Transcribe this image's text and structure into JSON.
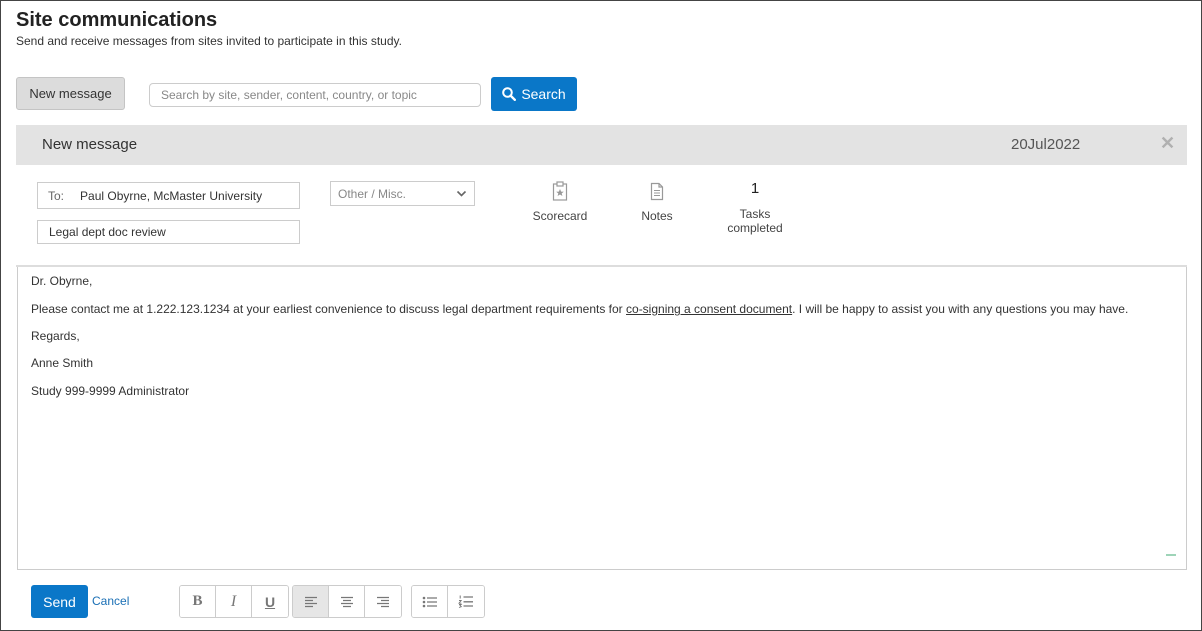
{
  "header": {
    "title": "Site communications",
    "subtitle": "Send and receive messages from sites invited to participate in this study."
  },
  "toolbar": {
    "new_message_label": "New message",
    "search_placeholder": "Search by site, sender, content, country, or topic",
    "search_label": "Search"
  },
  "panel": {
    "title": "New message",
    "date": "20Jul2022",
    "close_icon": "close-icon"
  },
  "compose": {
    "to_label": "To:",
    "to_value": "Paul Obyrne, McMaster University",
    "subject_value": "Legal dept doc review",
    "category_selected": "Other / Misc."
  },
  "tools": {
    "scorecard_label": "Scorecard",
    "notes_label": "Notes",
    "tasks_count": "1",
    "tasks_label": "Tasks completed"
  },
  "body": {
    "greeting": "Dr. Obyrne,",
    "para_before_link": "Please contact me at 1.222.123.1234 at your earliest convenience to discuss legal department requirements for ",
    "link_text": "co-signing a consent document",
    "para_after_link": ". I will be happy to assist you with any questions you may have.",
    "closing": "Regards,",
    "sender_name": "Anne Smith",
    "sender_title": "Study 999-9999 Administrator"
  },
  "footer": {
    "send_label": "Send",
    "cancel_label": "Cancel",
    "format_buttons": {
      "bold": "B",
      "italic": "I",
      "underline": "U"
    }
  },
  "colors": {
    "primary": "#0a77c8",
    "header_bg": "#e3e3e3",
    "link": "#1a6fb5"
  }
}
